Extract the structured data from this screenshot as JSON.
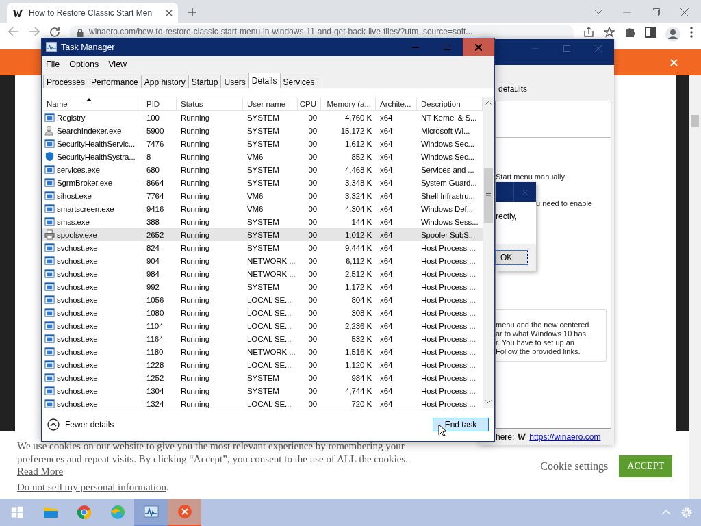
{
  "browser": {
    "tab_title": "How to Restore Classic Start Men",
    "url": "winaero.com/how-to-restore-classic-start-menu-in-windows-11-and-get-back-live-tiles/?utm_source=soft..."
  },
  "background_window": {
    "heading": "defaults",
    "lines": [
      "Start menu manually.",
      "u need to enable"
    ],
    "dialog": {
      "text": "rectly,",
      "button": "OK"
    },
    "info_lines": [
      "menu and the new centered",
      "ar to what Windows 10 has.",
      "r. You have to set up an",
      "Follow the provided links."
    ],
    "footer_label": "here:",
    "footer_link": "https://winaero.com"
  },
  "task_manager": {
    "title": "Task Manager",
    "menu": [
      "File",
      "Options",
      "View"
    ],
    "tabs": [
      {
        "label": "Processes",
        "selected": false
      },
      {
        "label": "Performance",
        "selected": false
      },
      {
        "label": "App history",
        "selected": false
      },
      {
        "label": "Startup",
        "selected": false
      },
      {
        "label": "Users",
        "selected": false
      },
      {
        "label": "Details",
        "selected": true
      },
      {
        "label": "Services",
        "selected": false
      }
    ],
    "columns": [
      "Name",
      "PID",
      "Status",
      "User name",
      "CPU",
      "Memory (a...",
      "Archite...",
      "Description"
    ],
    "rows": [
      {
        "kind": "app",
        "cells": [
          "Registry",
          "100",
          "Running",
          "SYSTEM",
          "00",
          "4,760 K",
          "x64",
          "NT Kernel & S..."
        ],
        "selected": false
      },
      {
        "kind": "search",
        "cells": [
          "SearchIndexer.exe",
          "5900",
          "Running",
          "SYSTEM",
          "00",
          "15,172 K",
          "x64",
          "Microsoft Wi..."
        ],
        "selected": false
      },
      {
        "kind": "app",
        "cells": [
          "SecurityHealthServic...",
          "7476",
          "Running",
          "SYSTEM",
          "00",
          "1,612 K",
          "x64",
          "Windows Sec..."
        ],
        "selected": false
      },
      {
        "kind": "shield",
        "cells": [
          "SecurityHealthSystra...",
          "8",
          "Running",
          "VM6",
          "00",
          "852 K",
          "x64",
          "Windows Sec..."
        ],
        "selected": false
      },
      {
        "kind": "app",
        "cells": [
          "services.exe",
          "680",
          "Running",
          "SYSTEM",
          "00",
          "4,468 K",
          "x64",
          "Services and ..."
        ],
        "selected": false
      },
      {
        "kind": "app",
        "cells": [
          "SgrmBroker.exe",
          "8664",
          "Running",
          "SYSTEM",
          "00",
          "3,348 K",
          "x64",
          "System Guard..."
        ],
        "selected": false
      },
      {
        "kind": "app",
        "cells": [
          "sihost.exe",
          "7764",
          "Running",
          "VM6",
          "00",
          "3,324 K",
          "x64",
          "Shell Infrastru..."
        ],
        "selected": false
      },
      {
        "kind": "app",
        "cells": [
          "smartscreen.exe",
          "9416",
          "Running",
          "VM6",
          "00",
          "4,304 K",
          "x64",
          "Windows Def..."
        ],
        "selected": false
      },
      {
        "kind": "app",
        "cells": [
          "smss.exe",
          "388",
          "Running",
          "SYSTEM",
          "00",
          "144 K",
          "x64",
          "Windows Sess..."
        ],
        "selected": false
      },
      {
        "kind": "printer",
        "cells": [
          "spoolsv.exe",
          "2652",
          "Running",
          "SYSTEM",
          "00",
          "1,012 K",
          "x64",
          "Spooler SubS..."
        ],
        "selected": true
      },
      {
        "kind": "app",
        "cells": [
          "svchost.exe",
          "824",
          "Running",
          "SYSTEM",
          "00",
          "9,444 K",
          "x64",
          "Host Process ..."
        ],
        "selected": false
      },
      {
        "kind": "app",
        "cells": [
          "svchost.exe",
          "904",
          "Running",
          "NETWORK ...",
          "00",
          "6,112 K",
          "x64",
          "Host Process ..."
        ],
        "selected": false
      },
      {
        "kind": "app",
        "cells": [
          "svchost.exe",
          "984",
          "Running",
          "NETWORK ...",
          "00",
          "2,512 K",
          "x64",
          "Host Process ..."
        ],
        "selected": false
      },
      {
        "kind": "app",
        "cells": [
          "svchost.exe",
          "992",
          "Running",
          "SYSTEM",
          "00",
          "1,172 K",
          "x64",
          "Host Process ..."
        ],
        "selected": false
      },
      {
        "kind": "app",
        "cells": [
          "svchost.exe",
          "1056",
          "Running",
          "LOCAL SE...",
          "00",
          "804 K",
          "x64",
          "Host Process ..."
        ],
        "selected": false
      },
      {
        "kind": "app",
        "cells": [
          "svchost.exe",
          "1080",
          "Running",
          "LOCAL SE...",
          "00",
          "308 K",
          "x64",
          "Host Process ..."
        ],
        "selected": false
      },
      {
        "kind": "app",
        "cells": [
          "svchost.exe",
          "1104",
          "Running",
          "LOCAL SE...",
          "00",
          "2,236 K",
          "x64",
          "Host Process ..."
        ],
        "selected": false
      },
      {
        "kind": "app",
        "cells": [
          "svchost.exe",
          "1164",
          "Running",
          "LOCAL SE...",
          "00",
          "532 K",
          "x64",
          "Host Process ..."
        ],
        "selected": false
      },
      {
        "kind": "app",
        "cells": [
          "svchost.exe",
          "1180",
          "Running",
          "NETWORK ...",
          "00",
          "1,516 K",
          "x64",
          "Host Process ..."
        ],
        "selected": false
      },
      {
        "kind": "app",
        "cells": [
          "svchost.exe",
          "1228",
          "Running",
          "LOCAL SE...",
          "00",
          "1,120 K",
          "x64",
          "Host Process ..."
        ],
        "selected": false
      },
      {
        "kind": "app",
        "cells": [
          "svchost.exe",
          "1252",
          "Running",
          "SYSTEM",
          "00",
          "984 K",
          "x64",
          "Host Process ..."
        ],
        "selected": false
      },
      {
        "kind": "app",
        "cells": [
          "svchost.exe",
          "1304",
          "Running",
          "SYSTEM",
          "00",
          "4,744 K",
          "x64",
          "Host Process ..."
        ],
        "selected": false
      },
      {
        "kind": "app",
        "cells": [
          "svchost.exe",
          "1324",
          "Running",
          "LOCAL SE...",
          "00",
          "720 K",
          "x64",
          "Host Process ..."
        ],
        "selected": false
      }
    ],
    "fewer_details": "Fewer details",
    "end_task": "End task"
  },
  "cookie_banner": {
    "text": "We use cookies on our website to give you the most relevant experience by remembering your preferences and repeat visits. By clicking “Accept”, you consent to the use of ALL the cookies.",
    "read_more": "Read More",
    "do_not_sell": "Do not sell my personal information",
    "do_not_sell_suffix": ".",
    "settings": "Cookie settings",
    "accept": "ACCEPT"
  },
  "taskbar": {
    "apps": [
      {
        "kind": "folder",
        "active": false
      },
      {
        "kind": "chrome",
        "active": false
      },
      {
        "kind": "edge",
        "active": false
      },
      {
        "kind": "taskmanager",
        "active": true
      },
      {
        "kind": "closeapp",
        "active": true
      }
    ]
  }
}
